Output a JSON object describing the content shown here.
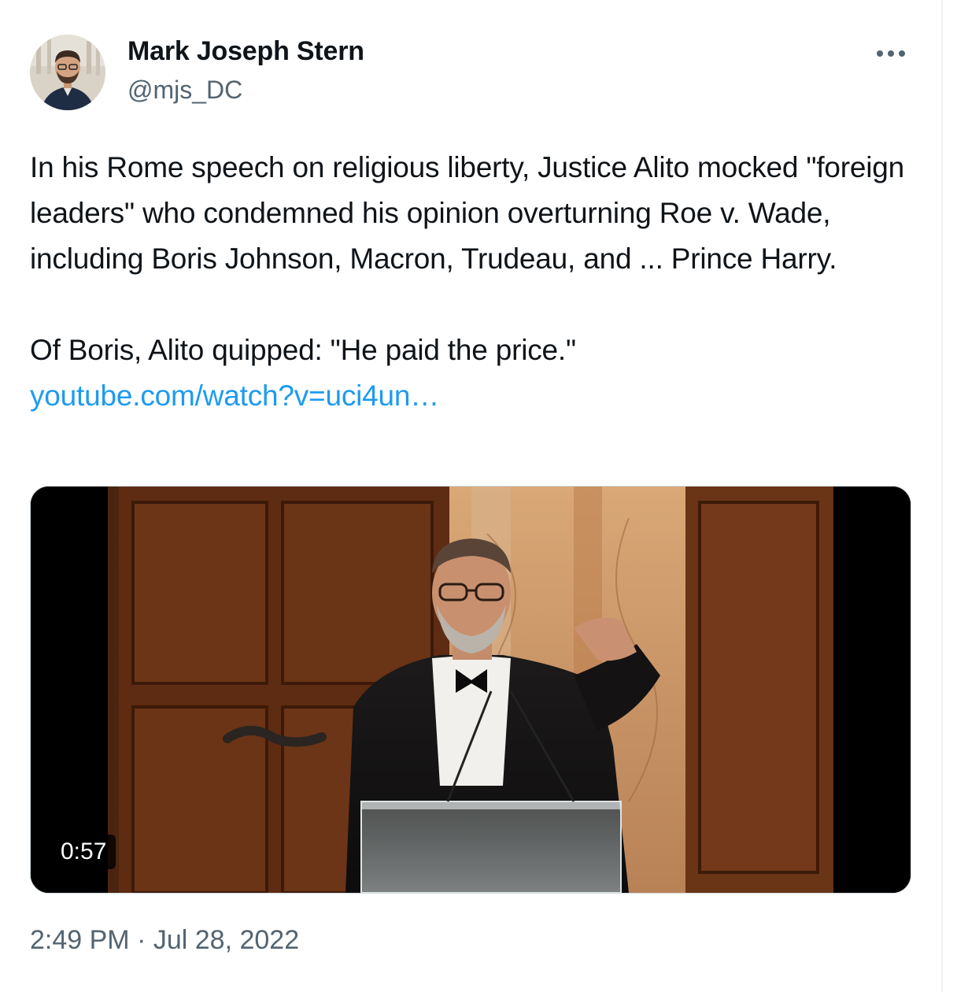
{
  "tweet": {
    "author": {
      "name": "Mark Joseph Stern",
      "handle": "@mjs_DC"
    },
    "text_paragraph_1": "In his Rome speech on religious liberty, Justice Alito mocked \"foreign leaders\" who condemned his opinion overturning Roe v. Wade, including Boris Johnson, Macron, Trudeau, and ... Prince Harry.",
    "text_paragraph_2": "Of Boris, Alito quipped: \"He paid the price.\"",
    "link": "youtube.com/watch?v=uci4un…",
    "video": {
      "duration": "0:57"
    },
    "time": "2:49 PM",
    "separator": "·",
    "date": "Jul 28, 2022"
  },
  "icons": {
    "more": "more-horizontal-icon"
  },
  "colors": {
    "text": "#0f1419",
    "secondary": "#536471",
    "link": "#1d9bf0",
    "border": "#cfd9de"
  }
}
